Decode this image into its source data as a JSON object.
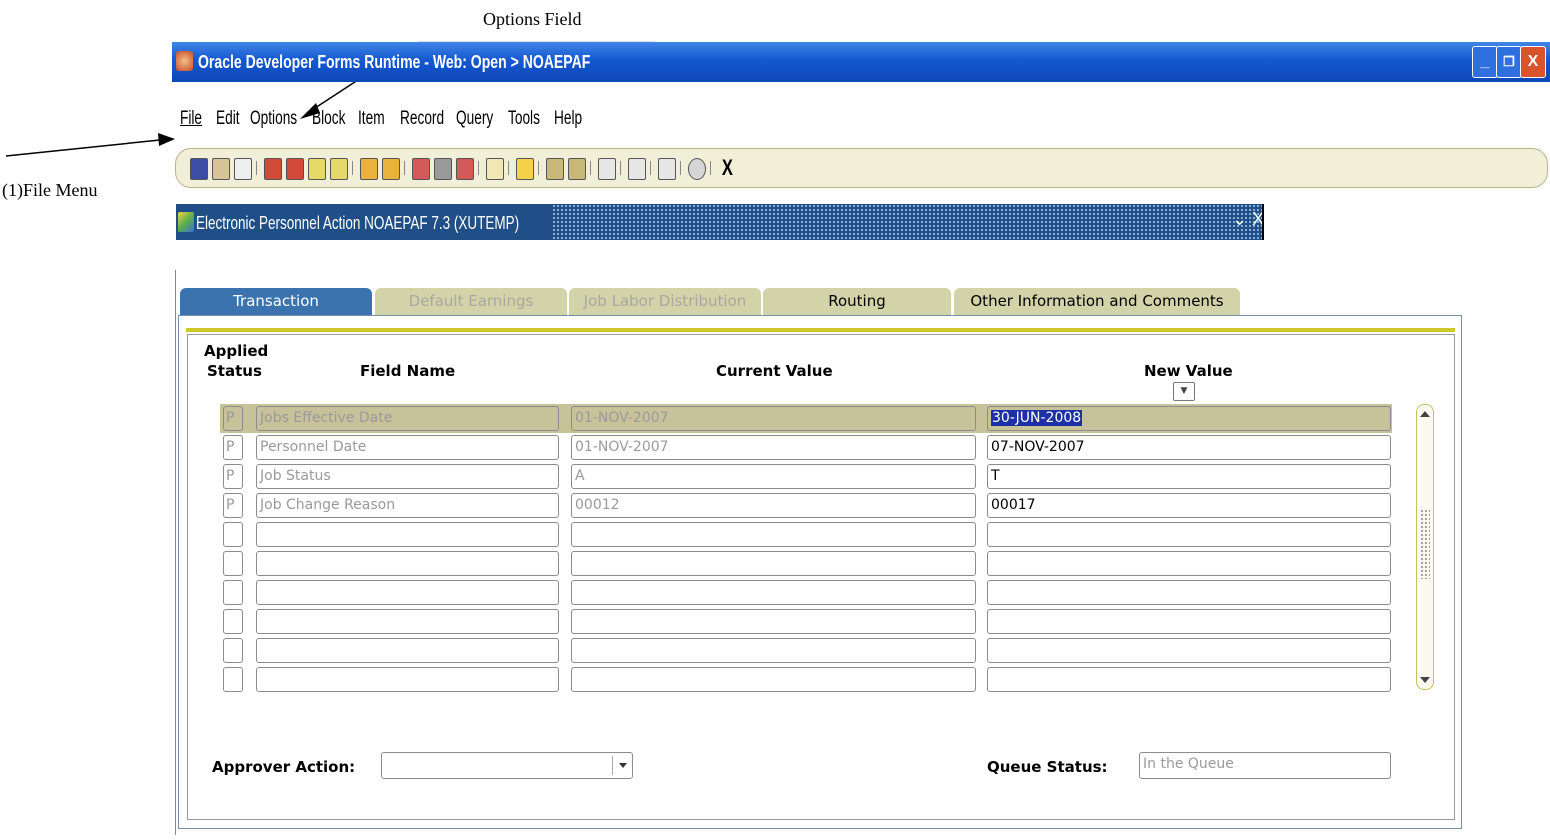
{
  "annotations": {
    "options_field": "Options Field",
    "file_menu": "(1)File Menu"
  },
  "window": {
    "title": "Oracle Developer Forms Runtime - Web:  Open > NOAEPAF",
    "controls": {
      "minimize": "_",
      "restore": "❐",
      "close": "X"
    }
  },
  "menu": [
    "File",
    "Edit",
    "Options",
    "Block",
    "Item",
    "Record",
    "Query",
    "Tools",
    "Help"
  ],
  "toolbar": {
    "exit_label": "X"
  },
  "form": {
    "title": "Electronic Personnel Action  NOAEPAF  7.3  (XUTEMP)",
    "title_controls": "⌄ X"
  },
  "tabs": [
    {
      "label": "Transaction",
      "state": "active"
    },
    {
      "label": "Default Earnings",
      "state": "disabled"
    },
    {
      "label": "Job Labor Distribution",
      "state": "disabled"
    },
    {
      "label": "Routing",
      "state": "normal"
    },
    {
      "label": "Other Information and Comments",
      "state": "normal"
    }
  ],
  "columns": {
    "applied_1": "Applied",
    "applied_2": "Status",
    "field_name": "Field Name",
    "current_value": "Current Value",
    "new_value": "New Value"
  },
  "rows": [
    {
      "status": "P",
      "field_name": "Jobs Effective Date",
      "current_value": "01-NOV-2007",
      "new_value": "30-JUN-2008"
    },
    {
      "status": "P",
      "field_name": "Personnel Date",
      "current_value": "01-NOV-2007",
      "new_value": "07-NOV-2007"
    },
    {
      "status": "P",
      "field_name": "Job Status",
      "current_value": "A",
      "new_value": "T"
    },
    {
      "status": "P",
      "field_name": "Job Change Reason",
      "current_value": "00012",
      "new_value": "00017"
    },
    {
      "status": "",
      "field_name": "",
      "current_value": "",
      "new_value": ""
    },
    {
      "status": "",
      "field_name": "",
      "current_value": "",
      "new_value": ""
    },
    {
      "status": "",
      "field_name": "",
      "current_value": "",
      "new_value": ""
    },
    {
      "status": "",
      "field_name": "",
      "current_value": "",
      "new_value": ""
    },
    {
      "status": "",
      "field_name": "",
      "current_value": "",
      "new_value": ""
    },
    {
      "status": "",
      "field_name": "",
      "current_value": "",
      "new_value": ""
    }
  ],
  "approver_action": {
    "label": "Approver Action:",
    "value": ""
  },
  "queue_status": {
    "label": "Queue Status:",
    "value": "In the Queue"
  },
  "colors": {
    "titlebar": "#1558d0",
    "form_title": "#1f4f86",
    "active_tab": "#3a73ad",
    "tab": "#d2d3a8",
    "yellow_bar": "#cfc82a",
    "selection": "#1c2fa6"
  }
}
